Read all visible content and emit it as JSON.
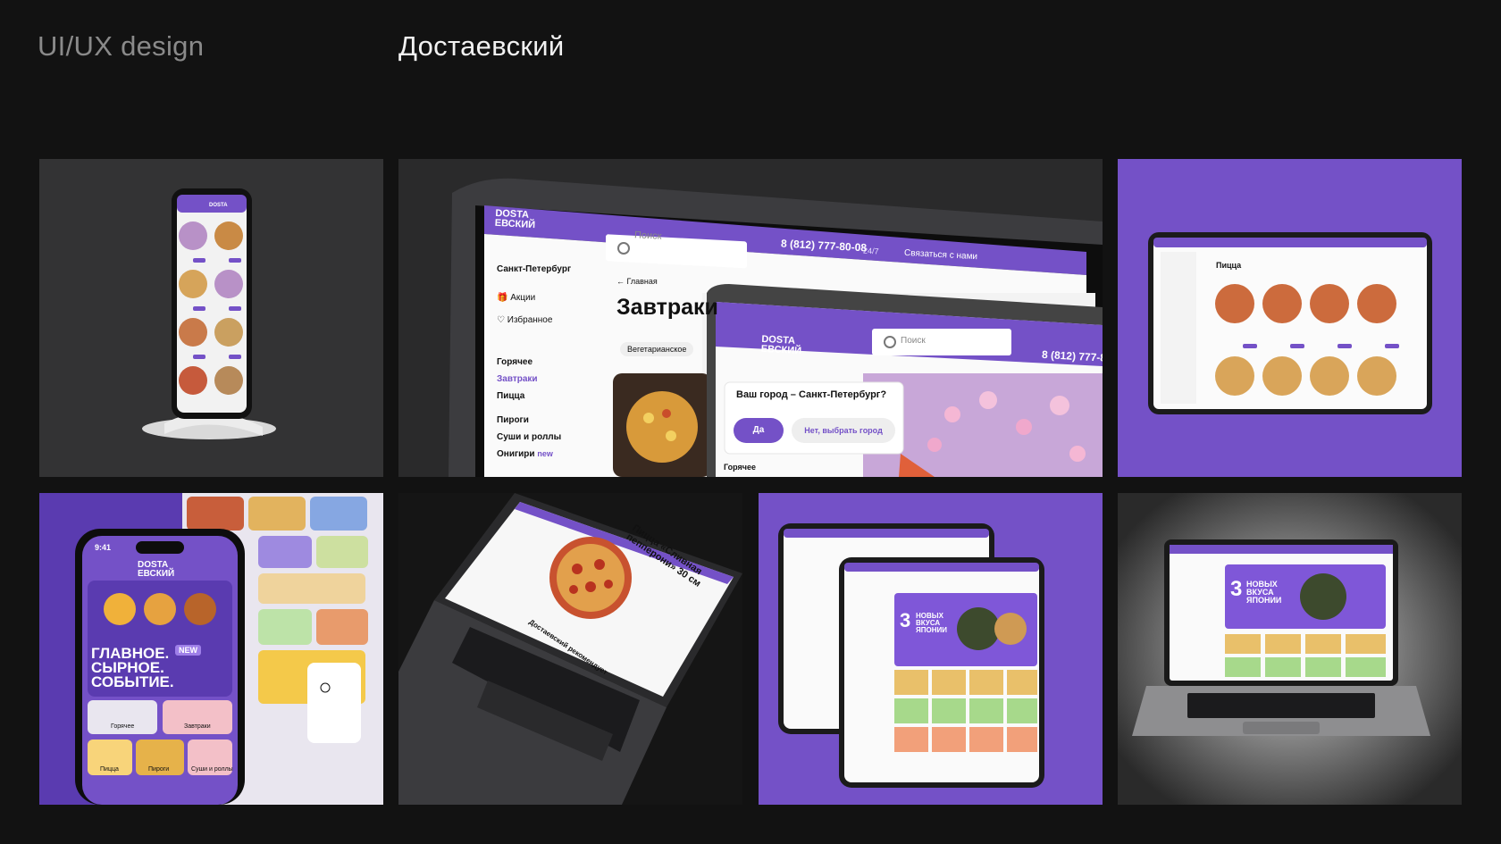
{
  "header": {
    "category": "UI/UX design",
    "project": "Достаевский"
  },
  "colors": {
    "background": "#121212",
    "brand_purple": "#7451c7",
    "tile_dark": "#2f2f30"
  },
  "logo": {
    "line1": "DOSTA",
    "line2": "EВСКИЙ"
  },
  "tablet_site": {
    "search_placeholder": "Поиск",
    "phone": "8 (812) 777-80-08",
    "phone_badge": "24/7",
    "contact_link": "Связаться с нами",
    "city": "Санкт-Петербург",
    "nav_promos": "Акции",
    "nav_favorites": "Избранное",
    "categories": [
      "Горячее",
      "Завтраки",
      "Пицца",
      "Пироги",
      "Суши и роллы",
      "Онигири"
    ],
    "category_new": "new",
    "breadcrumb": "Главная",
    "page_title": "Завтраки",
    "chip": "Вегетарианское",
    "phone_short": "8 (812) 777-80",
    "city_question": "Ваш город – Санкт-Петербург?",
    "yes_button": "Да",
    "no_button": "Нет, выбрать город",
    "footer_category": "Горячее"
  },
  "tablet_page": {
    "title": "Пицца"
  },
  "phone_app": {
    "time": "9:41",
    "promo_line1": "ГЛАВНОЕ.",
    "promo_line2": "СЫРНОЕ.",
    "promo_line3": "СОБЫТИЕ.",
    "promo_badge": "NEW",
    "cats": [
      "Горячее",
      "Завтраки",
      "Пицца",
      "Пироги",
      "Суши и роллы"
    ]
  },
  "laptop_page": {
    "product": "Пицца «Сливная пепперони» 30 см",
    "recommend": "Достаевский рекомендует"
  },
  "banner": {
    "num": "3",
    "line1": "НОВЫХ",
    "line2": "ВКУСА",
    "line3": "ЯПОНИИ"
  }
}
